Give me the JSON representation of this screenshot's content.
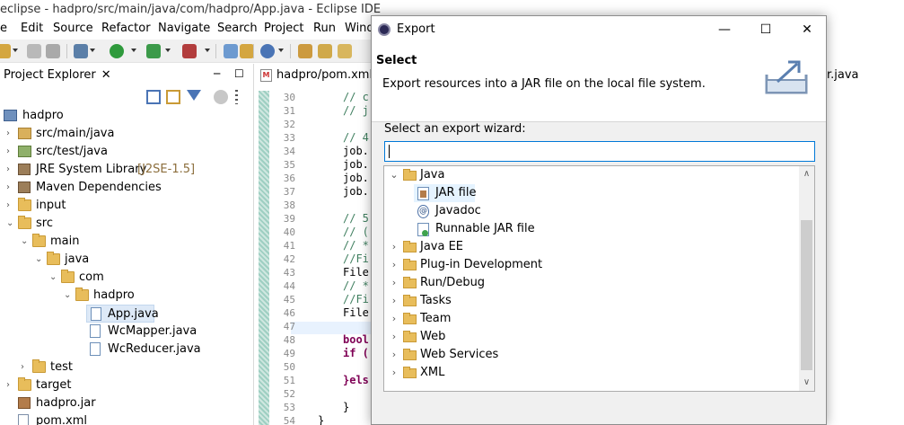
{
  "window": {
    "title": "eclipse - hadpro/src/main/java/com/hadpro/App.java - Eclipse IDE"
  },
  "menu": [
    "e",
    "Edit",
    "Source",
    "Refactor",
    "Navigate",
    "Search",
    "Project",
    "Run",
    "Wind"
  ],
  "project_explorer": {
    "tab_label": "Project Explorer",
    "close_glyph": "✕",
    "minimize_glyph": "─",
    "maximize_glyph": "☐",
    "tree": [
      {
        "label": "hadpro",
        "suffix": ""
      },
      {
        "label": "src/main/java",
        "suffix": ""
      },
      {
        "label": "src/test/java",
        "suffix": ""
      },
      {
        "label": "JRE System Library",
        "suffix": "[J2SE-1.5]"
      },
      {
        "label": "Maven Dependencies",
        "suffix": ""
      },
      {
        "label": "input",
        "suffix": ""
      },
      {
        "label": "src",
        "suffix": ""
      },
      {
        "label": "main",
        "suffix": ""
      },
      {
        "label": "java",
        "suffix": ""
      },
      {
        "label": "com",
        "suffix": ""
      },
      {
        "label": "hadpro",
        "suffix": ""
      },
      {
        "label": "App.java",
        "suffix": ""
      },
      {
        "label": "WcMapper.java",
        "suffix": ""
      },
      {
        "label": "WcReducer.java",
        "suffix": ""
      },
      {
        "label": "test",
        "suffix": ""
      },
      {
        "label": "target",
        "suffix": ""
      },
      {
        "label": "hadpro.jar",
        "suffix": ""
      },
      {
        "label": "pom.xml",
        "suffix": ""
      }
    ]
  },
  "editor": {
    "tab_label": "hadpro/pom.xml",
    "right_tab_label": "r.java",
    "line_numbers": [
      "30",
      "31",
      "32",
      "33",
      "34",
      "35",
      "36",
      "37",
      "38",
      "39",
      "40",
      "41",
      "42",
      "43",
      "44",
      "45",
      "46",
      "47",
      "48",
      "49",
      "50",
      "51",
      "52",
      "53",
      "54"
    ],
    "code": [
      "// c",
      "// j",
      "",
      "// 4",
      "job.",
      "job.",
      "job.",
      "job.",
      "",
      "// 5",
      "// (",
      "// *",
      "//Fi",
      "File",
      "// *",
      "//Fi",
      "File",
      "",
      "bool",
      "if (",
      "",
      "}els",
      "",
      "}",
      "}"
    ]
  },
  "dialog": {
    "title": "Export",
    "header_title": "Select",
    "header_desc": "Export resources into a JAR file on the local file system.",
    "wizard_label": "Select an export wizard:",
    "filter_value": "",
    "tree": [
      {
        "label": "Java",
        "type": "folder",
        "expanded": true
      },
      {
        "label": "JAR file",
        "type": "jar",
        "selected": true
      },
      {
        "label": "Javadoc",
        "type": "doc"
      },
      {
        "label": "Runnable JAR file",
        "type": "run"
      },
      {
        "label": "Java EE",
        "type": "folder"
      },
      {
        "label": "Plug-in Development",
        "type": "folder"
      },
      {
        "label": "Run/Debug",
        "type": "folder"
      },
      {
        "label": "Tasks",
        "type": "folder"
      },
      {
        "label": "Team",
        "type": "folder"
      },
      {
        "label": "Web",
        "type": "folder"
      },
      {
        "label": "Web Services",
        "type": "folder"
      },
      {
        "label": "XML",
        "type": "folder"
      }
    ],
    "minimize_glyph": "—",
    "maximize_glyph": "☐",
    "close_glyph": "✕"
  }
}
